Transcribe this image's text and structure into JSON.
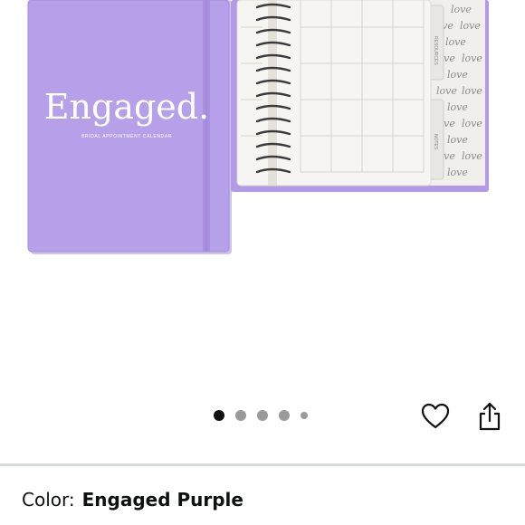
{
  "product": {
    "cover_title": "Engaged.",
    "cover_subtitle": "BRIDAL APPOINTMENT CALENDAR",
    "tab_labels": [
      "RESOURCES",
      "NOTES"
    ],
    "pattern_word": "love"
  },
  "gallery": {
    "image_count": 5,
    "active_index": 0
  },
  "actions": {
    "wishlist_icon": "heart-icon",
    "share_icon": "share-icon"
  },
  "variant": {
    "label": "Color:",
    "value": "Engaged Purple"
  },
  "colors": {
    "cover": "#b7a0ea",
    "inner_cover": "#b39ae6",
    "page": "#f7f5f1"
  }
}
